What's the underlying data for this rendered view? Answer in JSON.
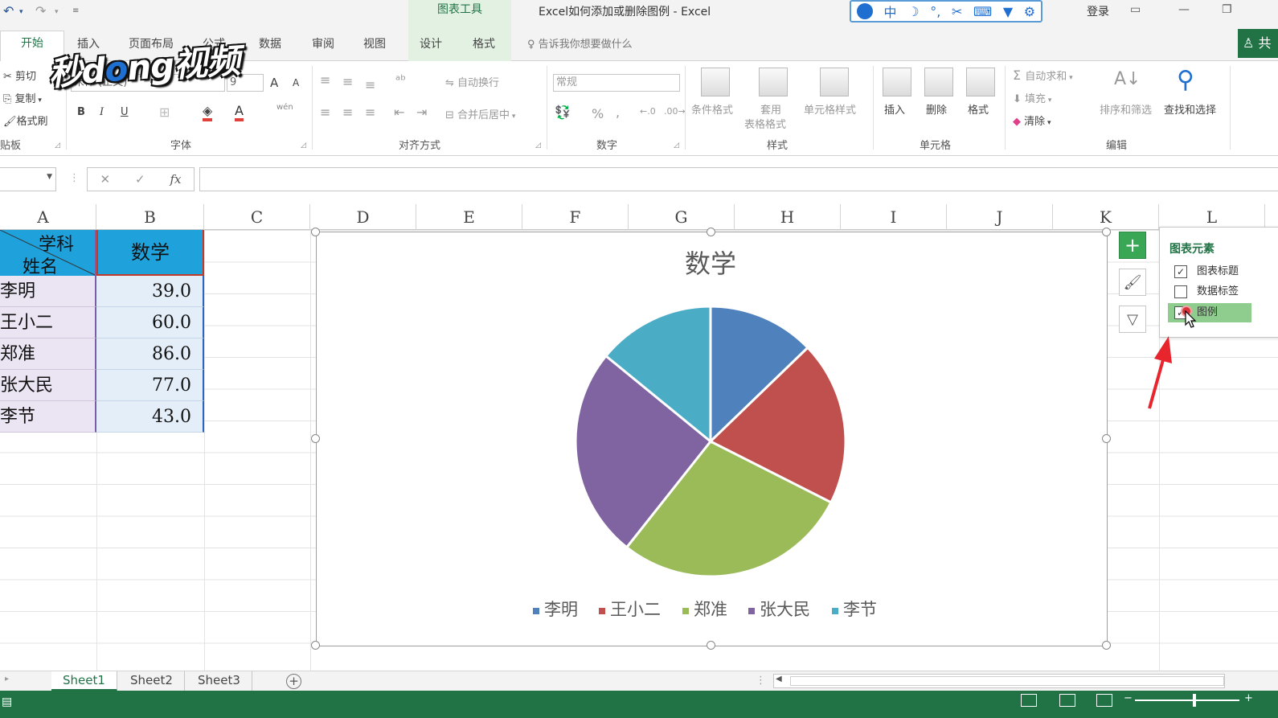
{
  "titlebar": {
    "undo_icon": "undo-icon",
    "redo_icon": "redo-icon",
    "chart_tools_label": "图表工具",
    "document_title": "Excel如何添加或删除图例",
    "app_separator": "-",
    "app_name": "Excel",
    "ime_glyphs": [
      "中",
      "☽",
      "°,",
      "✂",
      "⌨",
      "👕",
      "⚙"
    ],
    "login": "登录"
  },
  "tabs": {
    "home": "开始",
    "insert": "插入",
    "page_layout": "页面布局",
    "formulas": "公式",
    "data": "数据",
    "review": "审阅",
    "view": "视图",
    "design": "设计",
    "format": "格式",
    "tell_me": "告诉我你想要做什么",
    "share": "共"
  },
  "logo_text": "秒懂视频",
  "ribbon": {
    "clipboard": {
      "cut": "剪切",
      "copy": "复制",
      "format_painter": "格式刷",
      "label": "贴板"
    },
    "font": {
      "name": "宋体 (正文)",
      "size": "9",
      "grow": "A",
      "shrink": "A",
      "bold": "B",
      "italic": "I",
      "underline": "U",
      "phonetic": "wén",
      "label": "字体"
    },
    "alignment": {
      "wrap_text": "自动换行",
      "merge_center": "合并后居中",
      "label": "对齐方式"
    },
    "number": {
      "format": "常规",
      "percent": "%",
      "comma": ",",
      "label": "数字"
    },
    "styles": {
      "conditional": "条件格式",
      "table_line1": "套用",
      "table_line2": "表格格式",
      "cell_styles": "单元格样式",
      "label": "样式"
    },
    "cells": {
      "insert": "插入",
      "delete": "删除",
      "format": "格式",
      "label": "单元格"
    },
    "editing": {
      "autosum": "自动求和",
      "fill": "填充",
      "clear": "清除",
      "sort_filter": "排序和筛选",
      "find_select": "查找和选择",
      "label": "编辑"
    }
  },
  "formula_bar": {
    "name_box": "",
    "cancel_glyph": "✕",
    "enter_glyph": "✓",
    "fx_glyph": "fx",
    "content": ""
  },
  "columns": [
    "A",
    "B",
    "C",
    "D",
    "E",
    "F",
    "G",
    "H",
    "I",
    "J",
    "K",
    "L"
  ],
  "table": {
    "header_subject": "学科",
    "header_name": "姓名",
    "header_math": "数学",
    "rows": [
      {
        "name": "李明",
        "math": "39.0"
      },
      {
        "name": "王小二",
        "math": "60.0"
      },
      {
        "name": "郑准",
        "math": "86.0"
      },
      {
        "name": "张大民",
        "math": "77.0"
      },
      {
        "name": "李节",
        "math": "43.0"
      }
    ]
  },
  "chart_data": {
    "type": "pie",
    "title": "数学",
    "categories": [
      "李明",
      "王小二",
      "郑准",
      "张大民",
      "李节"
    ],
    "values": [
      39,
      60,
      86,
      77,
      43
    ],
    "colors": [
      "#4f81bd",
      "#c0504d",
      "#9bbb59",
      "#8064a2",
      "#4bacc6"
    ],
    "legend_position": "bottom"
  },
  "chart_panel": {
    "title": "图表元素",
    "items": [
      {
        "label": "图表标题",
        "checked": true
      },
      {
        "label": "数据标签",
        "checked": false
      },
      {
        "label": "图例",
        "checked": true
      }
    ]
  },
  "sheets": [
    "Sheet1",
    "Sheet2",
    "Sheet3"
  ],
  "add_sheet": "+",
  "colors": {
    "excel_green": "#217346",
    "header_blue": "#1fa1dc",
    "arrow_red": "#e8242c"
  }
}
